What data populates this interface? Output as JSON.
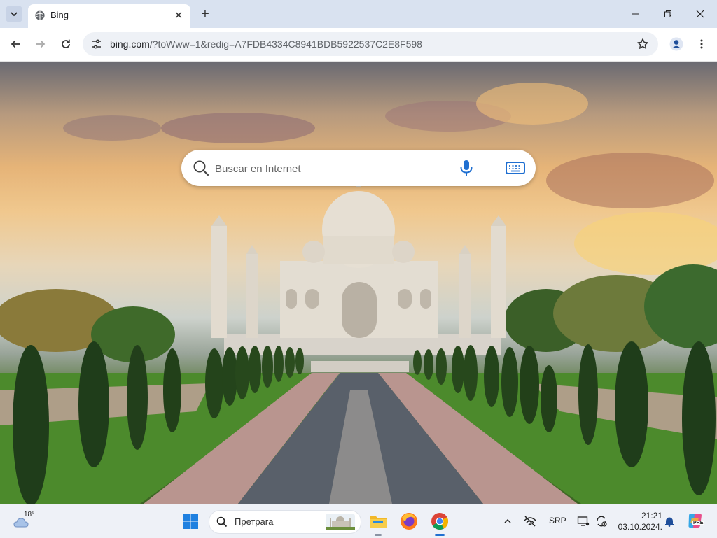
{
  "browser": {
    "tab": {
      "title": "Bing"
    },
    "omnibox": {
      "host": "bing.com",
      "path": "/?toWww=1&redig=A7FDB4334C8941BDB5922537C2E8F598"
    }
  },
  "page": {
    "search": {
      "placeholder": "Buscar en Internet"
    }
  },
  "taskbar": {
    "weather": {
      "temp": "18°"
    },
    "search": {
      "label": "Претрага"
    },
    "language": "SRP",
    "clock": {
      "time": "21:21",
      "date": "03.10.2024."
    },
    "copilot_badge": "PRE"
  },
  "colors": {
    "accent": "#1f6fd1",
    "titlebar": "#d9e2f0",
    "taskbar": "#eef1f7"
  },
  "icons": [
    "tab-list-icon",
    "bing-favicon",
    "close-icon",
    "plus-icon",
    "minimize-icon",
    "maximize-icon",
    "back-icon",
    "forward-icon",
    "reload-icon",
    "site-info-icon",
    "star-icon",
    "profile-icon",
    "menu-icon",
    "search-icon",
    "microphone-icon",
    "keyboard-icon",
    "weather-icon",
    "windows-icon",
    "file-explorer-icon",
    "firefox-icon",
    "chrome-icon",
    "chevron-up-icon",
    "network-icon",
    "display-icon",
    "sync-icon",
    "bell-icon",
    "copilot-icon"
  ]
}
